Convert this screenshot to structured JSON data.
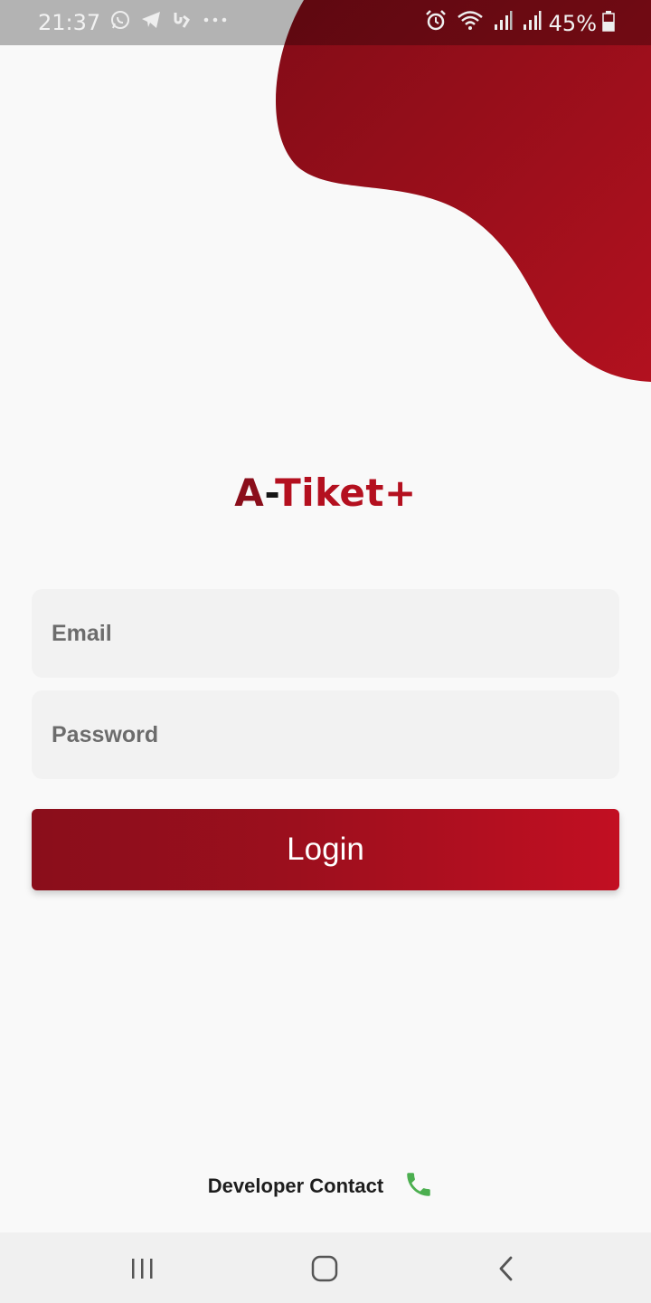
{
  "status_bar": {
    "time": "21:37",
    "battery": "45%",
    "icons_left": [
      "whatsapp-icon",
      "telegram-icon",
      "app-icon",
      "more-icon"
    ],
    "icons_right": [
      "alarm-icon",
      "wifi-icon",
      "signal-icon",
      "signal-icon",
      "battery-icon"
    ]
  },
  "brand": {
    "part_a": "A",
    "part_dash": "-",
    "part_rest": "Tiket+"
  },
  "form": {
    "email_placeholder": "Email",
    "email_value": "",
    "password_placeholder": "Password",
    "password_value": "",
    "login_label": "Login"
  },
  "footer": {
    "developer_contact": "Developer Contact",
    "contact_icon": "phone-icon"
  },
  "colors": {
    "primary": "#8a0e1b",
    "primary_light": "#c20f22",
    "field_bg": "#f2f2f2",
    "phone_green": "#4caf50"
  },
  "nav": {
    "buttons": [
      "recents-icon",
      "home-icon",
      "back-icon"
    ]
  }
}
